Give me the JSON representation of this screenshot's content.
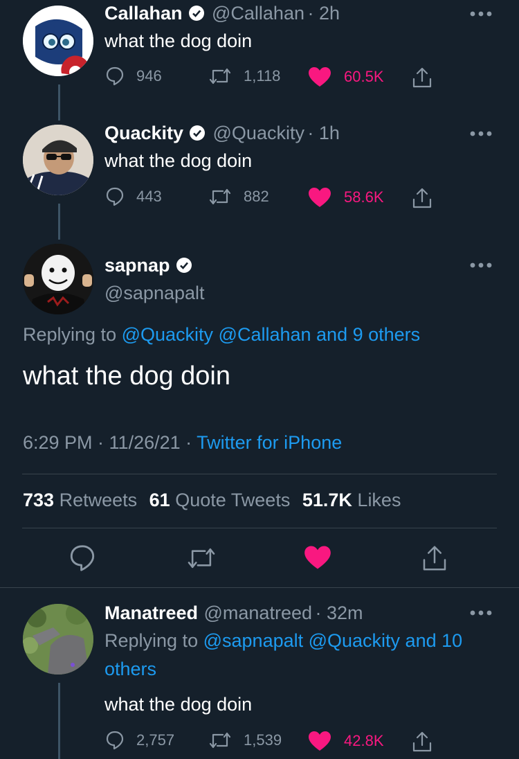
{
  "tweets": [
    {
      "name": "Callahan",
      "handle": "@Callahan",
      "time": "· 2h",
      "text": "what the dog doin",
      "replies": "946",
      "retweets": "1,118",
      "likes": "60.5K"
    },
    {
      "name": "Quackity",
      "handle": "@Quackity",
      "time": "· 1h",
      "text": "what the dog doin",
      "replies": "443",
      "retweets": "882",
      "likes": "58.6K"
    }
  ],
  "main_tweet": {
    "name": "sapnap",
    "handle": "@sapnapalt",
    "replying_prefix": "Replying to",
    "replying_mentions": "@Quackity @Callahan and 9 others",
    "text": "what the dog doin",
    "time": "6:29 PM · 11/26/21 ·",
    "source": "Twitter for iPhone",
    "stats": {
      "retweets_count": "733",
      "retweets_label": "Retweets",
      "quotes_count": "61",
      "quotes_label": "Quote Tweets",
      "likes_count": "51.7K",
      "likes_label": "Likes"
    }
  },
  "reply": {
    "name": "Manatreed",
    "handle": "@manatreed",
    "time": "· 32m",
    "replying_prefix": "Replying to",
    "replying_mentions": "@sapnapalt @Quackity and 10",
    "replying_mentions_2": "others",
    "text": "what the dog doin",
    "replies": "2,757",
    "retweets": "1,539",
    "likes": "42.8K"
  },
  "colors": {
    "background": "#15202b",
    "accent": "#1d9bf0",
    "like": "#f91880",
    "muted": "#8b98a5"
  }
}
